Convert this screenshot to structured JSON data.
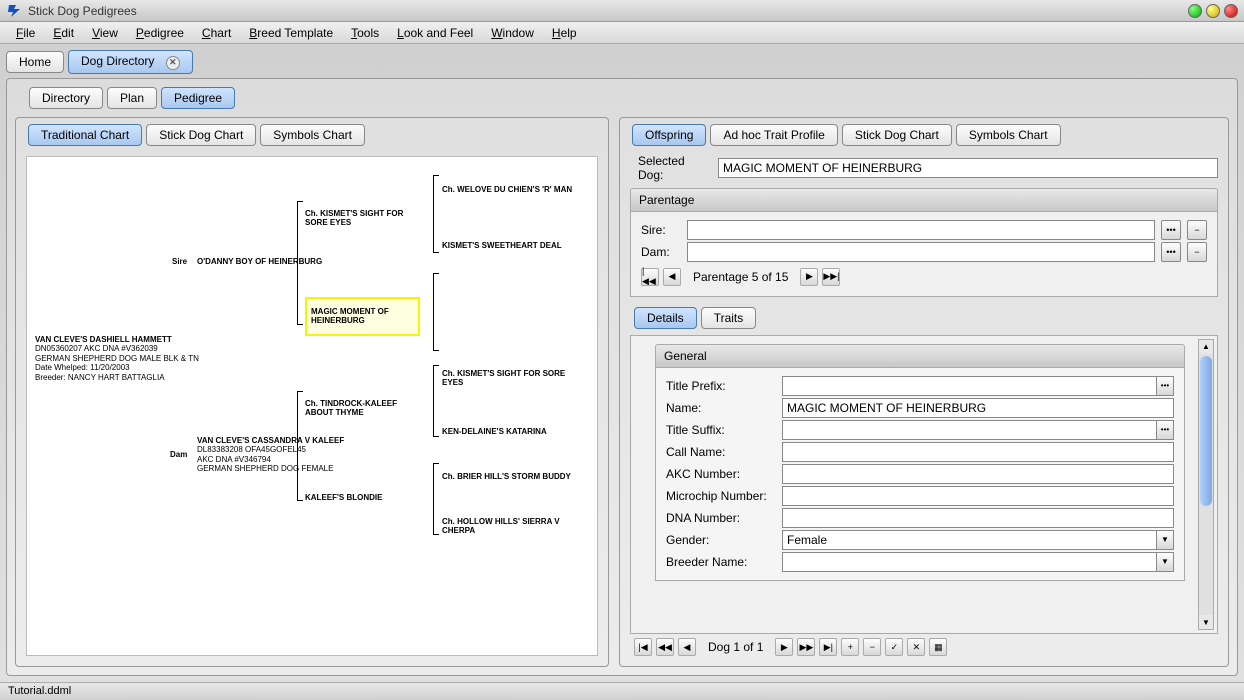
{
  "app": {
    "title": "Stick Dog Pedigrees"
  },
  "menubar": [
    "File",
    "Edit",
    "View",
    "Pedigree",
    "Chart",
    "Breed Template",
    "Tools",
    "Look and Feel",
    "Window",
    "Help"
  ],
  "main_tabs": [
    {
      "label": "Home",
      "closable": false,
      "active": false
    },
    {
      "label": "Dog Directory",
      "closable": true,
      "active": true
    }
  ],
  "sub_tabs": [
    "Directory",
    "Plan",
    "Pedigree"
  ],
  "sub_tab_active": 2,
  "left_chart_tabs": [
    "Traditional Chart",
    "Stick Dog Chart",
    "Symbols Chart"
  ],
  "left_chart_active": 0,
  "right_chart_tabs": [
    "Offspring",
    "Ad hoc Trait Profile",
    "Stick Dog Chart",
    "Symbols Chart"
  ],
  "right_chart_active": 0,
  "pedigree": {
    "sire_label": "Sire",
    "dam_label": "Dam",
    "subject": {
      "name": "VAN CLEVE'S DASHIELL HAMMETT",
      "line2": "DN05360207 AKC  DNA #V362039",
      "line3": "GERMAN SHEPHERD DOG MALE BLK & TN",
      "line4": "Date Whelped: 11/20/2003",
      "line5": "Breeder: NANCY HART BATTAGLIA"
    },
    "sire": "O'DANNY BOY OF HEINERBURG",
    "dam": {
      "name": "VAN CLEVE'S CASSANDRA V KALEEF",
      "line2": "DL83383208 OFA45GOFEL45 AKC DNA #V346794",
      "line3": "GERMAN SHEPHERD DOG FEMALE"
    },
    "gp_sire_sire": "Ch. KISMET'S SIGHT FOR SORE EYES",
    "gp_sire_dam": "MAGIC MOMENT OF HEINERBURG",
    "gp_dam_sire": "Ch. TINDROCK-KALEEF ABOUT THYME",
    "gp_dam_dam": "KALEEF'S BLONDIE",
    "ggp1": "Ch. WELOVE DU CHIEN'S 'R' MAN",
    "ggp2": "KISMET'S SWEETHEART DEAL",
    "ggp3": "Ch. KISMET'S SIGHT FOR SORE EYES",
    "ggp4": "KEN-DELAINE'S KATARINA",
    "ggp5": "Ch. BRIER HILL'S STORM BUDDY",
    "ggp6": "Ch. HOLLOW HILLS' SIERRA V CHERPA"
  },
  "right_panel": {
    "selected_dog_label": "Selected Dog:",
    "selected_dog_value": "MAGIC MOMENT OF HEINERBURG",
    "parentage_title": "Parentage",
    "sire_label": "Sire:",
    "dam_label": "Dam:",
    "sire_value": "",
    "dam_value": "",
    "parentage_nav": "Parentage 5 of 15",
    "inner_tabs": [
      "Details",
      "Traits"
    ],
    "inner_tab_active": 0,
    "general_title": "General",
    "fields": [
      {
        "label": "Title Prefix:",
        "value": "",
        "type": "combo-ellipsis"
      },
      {
        "label": "Name:",
        "value": "MAGIC MOMENT OF HEINERBURG",
        "type": "text"
      },
      {
        "label": "Title Suffix:",
        "value": "",
        "type": "combo-ellipsis"
      },
      {
        "label": "Call Name:",
        "value": "",
        "type": "text"
      },
      {
        "label": "AKC Number:",
        "value": "",
        "type": "text"
      },
      {
        "label": "Microchip Number:",
        "value": "",
        "type": "text"
      },
      {
        "label": "DNA Number:",
        "value": "",
        "type": "text"
      },
      {
        "label": "Gender:",
        "value": "Female",
        "type": "combo"
      },
      {
        "label": "Breeder Name:",
        "value": "",
        "type": "combo"
      }
    ],
    "dog_nav": "Dog 1 of 1"
  },
  "statusbar": "Tutorial.ddml"
}
